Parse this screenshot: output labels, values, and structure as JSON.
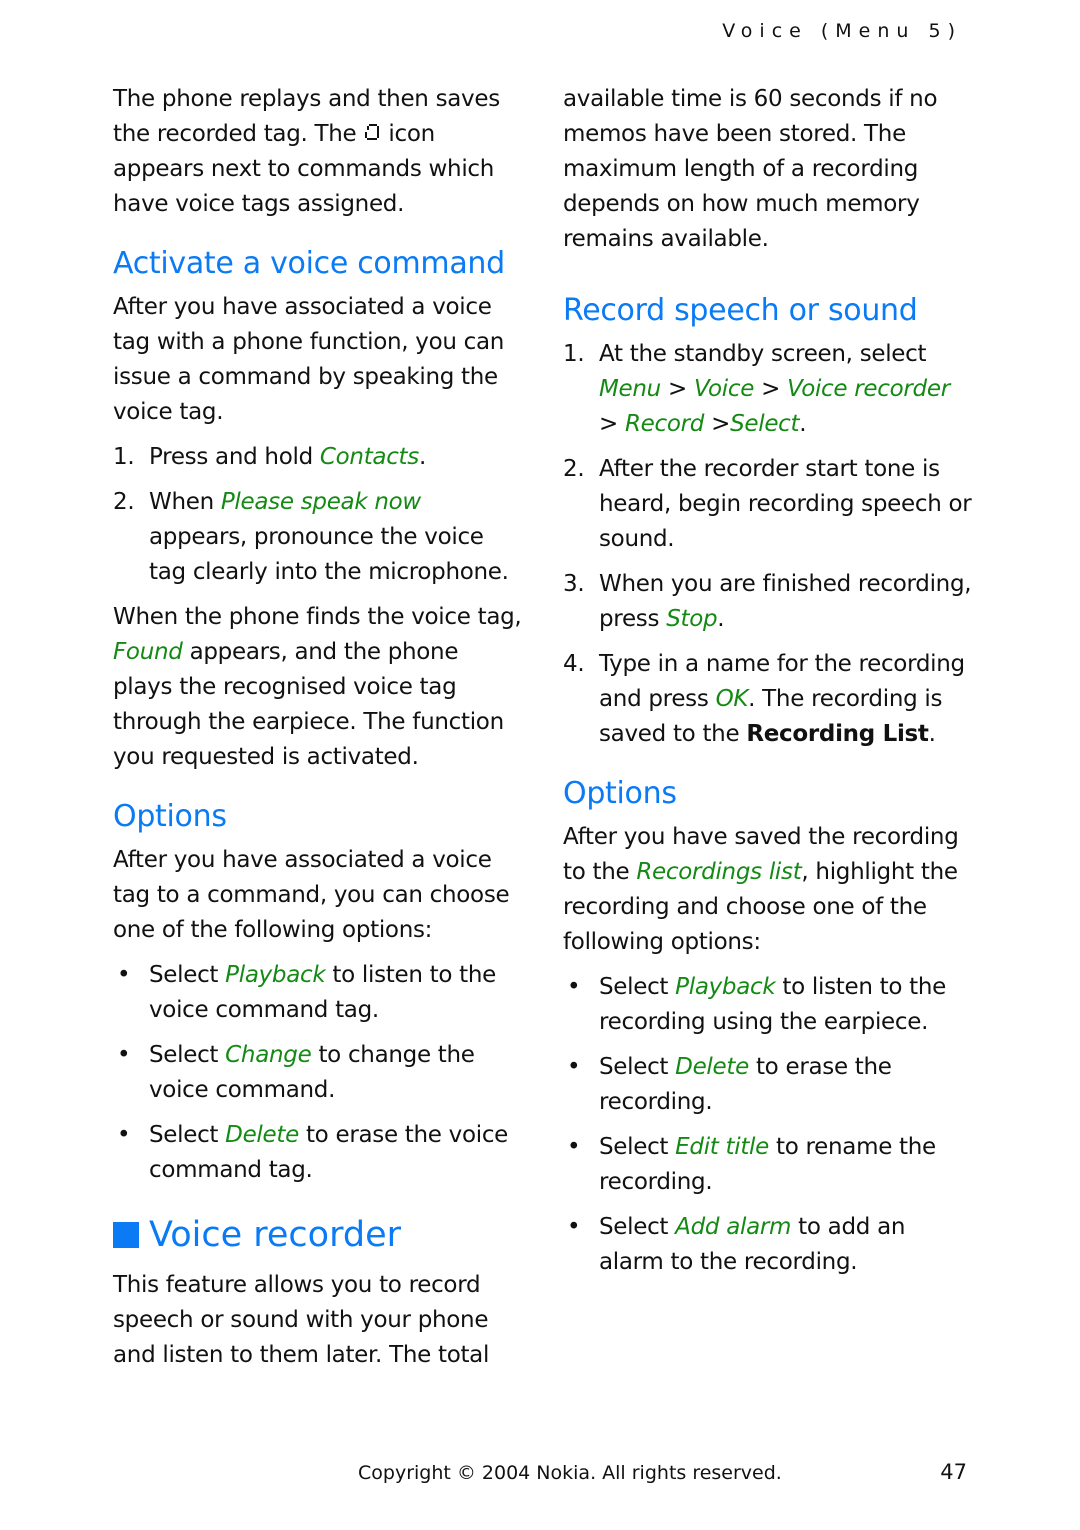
{
  "header": {
    "running_title": "Voice (Menu 5)"
  },
  "left": {
    "intro": {
      "part1": "The phone replays and then saves the recorded tag. The",
      "icon": "voice-tag-icon",
      "part2": "icon appears next to commands which have voice tags assigned."
    },
    "activate": {
      "heading": "Activate a voice command",
      "body": "After you have associated a voice tag with a phone function, you can issue a command by speaking the voice tag.",
      "steps": [
        {
          "num": "1.",
          "pre": "Press and hold ",
          "em": "Contacts",
          "post": "."
        },
        {
          "num": "2.",
          "pre": "When ",
          "em": "Please speak now",
          "post": " appears, pronounce the voice tag clearly into the microphone."
        }
      ],
      "after": {
        "pre": "When the phone finds the voice tag, ",
        "em": "Found",
        "post": " appears, and the phone plays the recognised voice tag through the earpiece. The function you requested is activated."
      }
    },
    "options": {
      "heading": "Options",
      "body": "After you have associated a voice tag to a command, you can choose one of the following options:",
      "bullets": [
        {
          "bullet": "•",
          "pre": "Select ",
          "em": "Playback",
          "post": " to listen to the voice command tag."
        },
        {
          "bullet": "•",
          "pre": "Select ",
          "em": "Change",
          "post": " to change the voice command."
        },
        {
          "bullet": "•",
          "pre": "Select ",
          "em": "Delete",
          "post": " to erase the voice command tag."
        }
      ]
    },
    "recorder": {
      "heading": "Voice recorder",
      "body": "This feature allows you to record speech or sound with your phone and listen to them later. The total"
    }
  },
  "right": {
    "continued": "available time is 60 seconds if no memos have been stored. The maximum length of a recording depends on how much memory remains available.",
    "record": {
      "heading": "Record speech or sound",
      "step1": {
        "num": "1.",
        "pre": "At the standby screen, select ",
        "path": [
          "Menu",
          "Voice",
          "Voice recorder",
          "Record",
          "Select"
        ],
        "sep": " > "
      },
      "step2": {
        "num": "2.",
        "text": "After the recorder start tone is heard, begin recording speech or sound."
      },
      "step3": {
        "num": "3.",
        "pre": "When you are finished recording, press ",
        "em": "Stop",
        "post": "."
      },
      "step4": {
        "num": "4.",
        "pre": "Type in a name for the recording and press ",
        "em": "OK",
        "mid": ". The recording is saved to the ",
        "bold": "Recording List",
        "post": "."
      }
    },
    "options": {
      "heading": "Options",
      "body": {
        "pre": "After you have saved the recording to the ",
        "em": "Recordings list",
        "post": ", highlight the recording and choose one of the following options:"
      },
      "bullets": [
        {
          "bullet": "•",
          "pre": "Select ",
          "em": "Playback",
          "post": " to listen to the recording using the earpiece."
        },
        {
          "bullet": "•",
          "pre": "Select ",
          "em": "Delete",
          "post": " to erase the recording."
        },
        {
          "bullet": "•",
          "pre": "Select ",
          "em": "Edit title",
          "post": " to rename the recording."
        },
        {
          "bullet": "•",
          "pre": "Select ",
          "em": "Add alarm",
          "post": " to add an alarm to the recording."
        }
      ]
    }
  },
  "footer": {
    "copyright": "Copyright © 2004 Nokia. All rights reserved.",
    "page_number": "47"
  },
  "colors": {
    "heading_blue": "#0a7bf5",
    "menu_term_green": "#148a14",
    "text": "#111111"
  }
}
